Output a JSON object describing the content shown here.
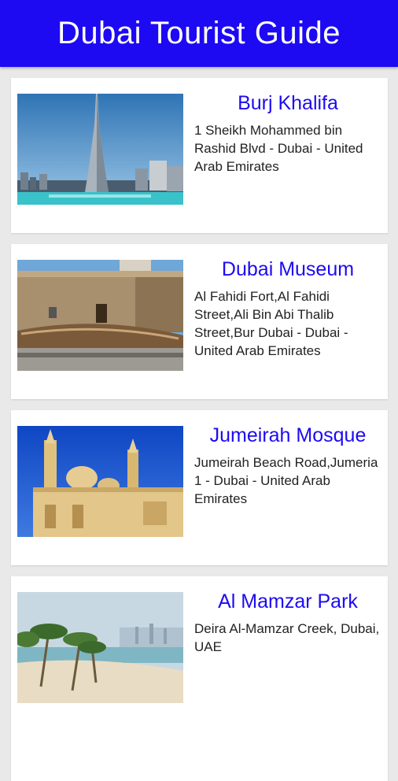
{
  "header": {
    "title": "Dubai Tourist Guide"
  },
  "places": [
    {
      "name": "Burj Khalifa",
      "address": "1 Sheikh Mohammed bin Rashid Blvd - Dubai - United Arab Emirates",
      "image": "burj-khalifa-photo"
    },
    {
      "name": "Dubai Museum",
      "address": "Al Fahidi Fort,Al Fahidi Street,Ali Bin Abi Thalib Street,Bur Dubai - Dubai - United Arab Emirates",
      "image": "dubai-museum-photo"
    },
    {
      "name": "Jumeirah Mosque",
      "address": "Jumeirah Beach Road,Jumeria 1 - Dubai - United Arab Emirates",
      "image": "jumeirah-mosque-photo"
    },
    {
      "name": "Al Mamzar Park",
      "address": "Deira Al-Mamzar Creek, Dubai, UAE",
      "image": "al-mamzar-park-photo"
    }
  ],
  "colors": {
    "header": "#1d0af2",
    "title": "#1d0af2",
    "background": "#e9e9e9"
  }
}
